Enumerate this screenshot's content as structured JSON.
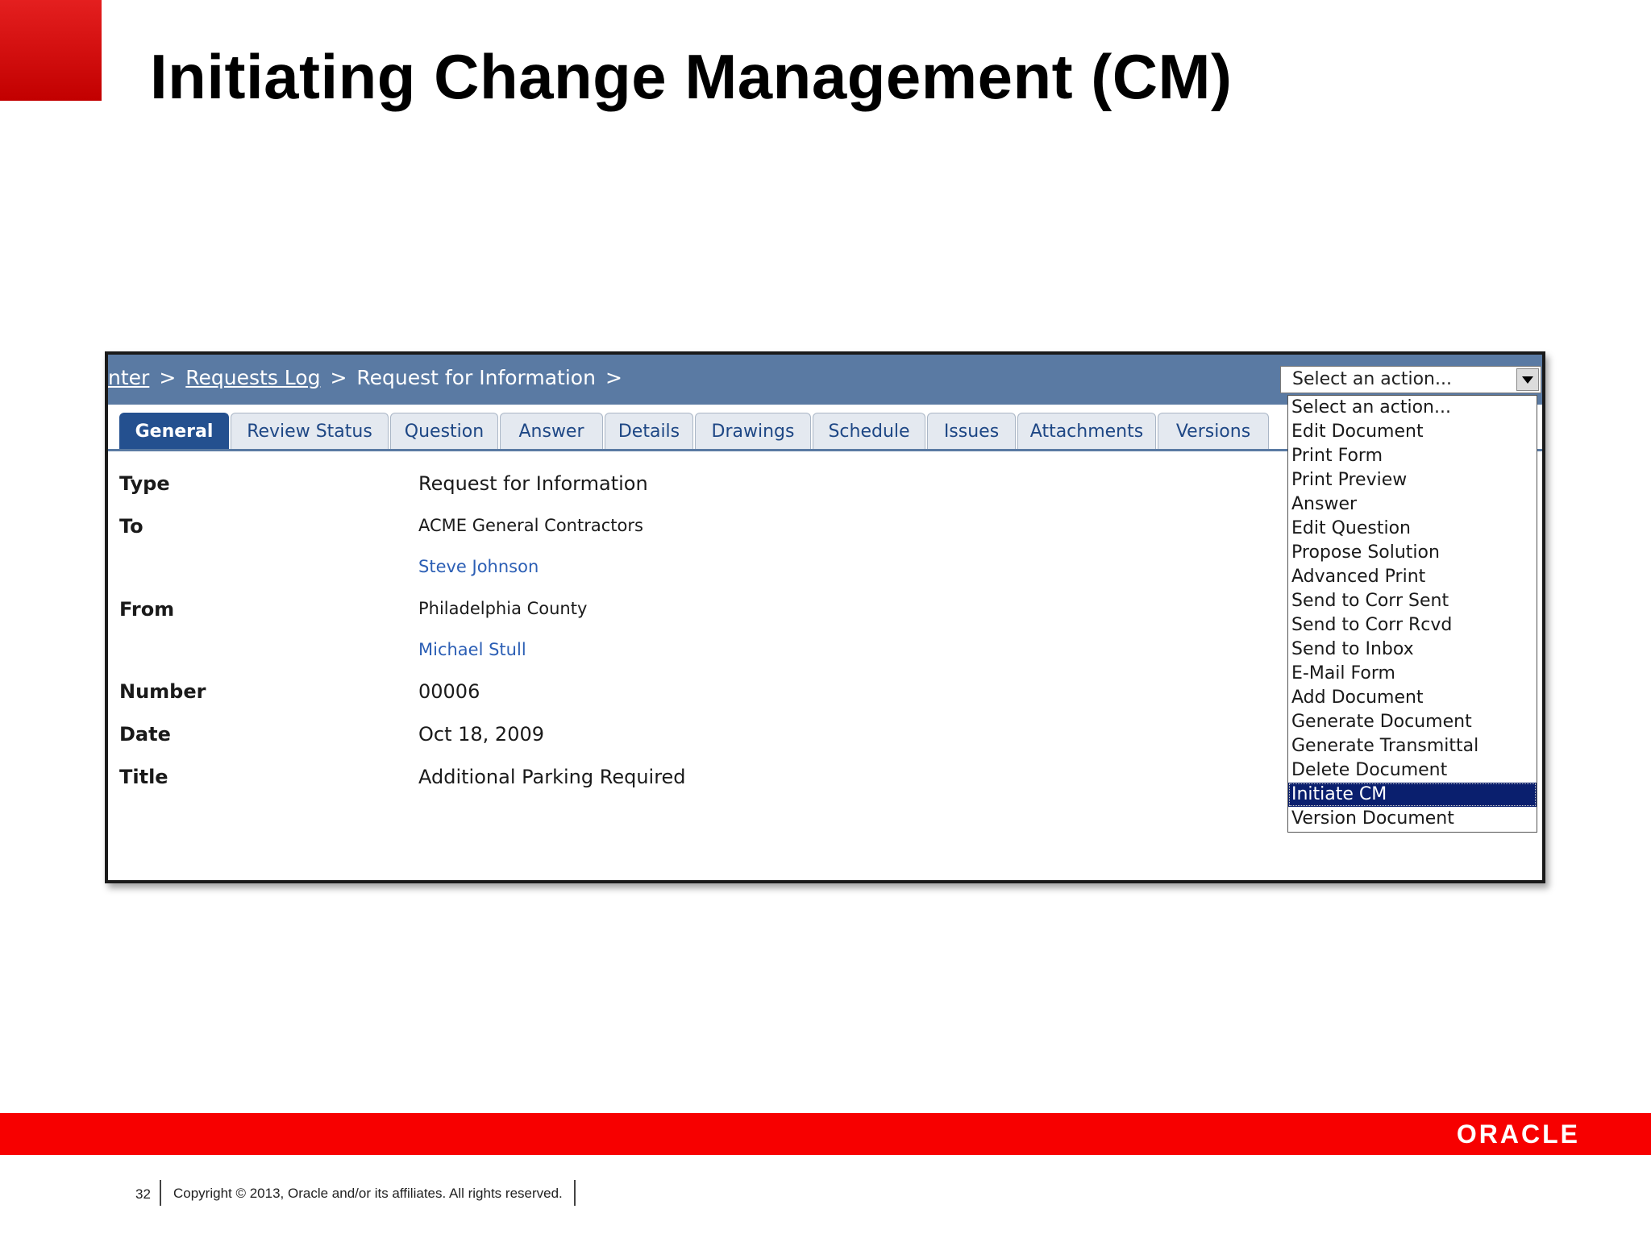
{
  "slide": {
    "title": "Initiating Change Management (CM)",
    "page_number": "32",
    "copyright": "Copyright © 2013, Oracle and/or its affiliates. All rights reserved.",
    "logo_text": "ORACLE"
  },
  "breadcrumb": {
    "item1": "nter",
    "item2": "Requests Log",
    "item3": "Request for Information",
    "separator": ">"
  },
  "action_select": {
    "value": "Select an action...",
    "options": [
      "Select an action...",
      "Edit Document",
      "Print Form",
      "Print Preview",
      "Answer",
      "Edit Question",
      "Propose Solution",
      "Advanced Print",
      "Send to Corr Sent",
      "Send to Corr Rcvd",
      "Send to Inbox",
      "E-Mail Form",
      "Add Document",
      "Generate Document",
      "Generate Transmittal",
      "Delete Document",
      "Initiate CM",
      "Version Document"
    ],
    "highlighted": "Initiate CM"
  },
  "tabs": [
    "General",
    "Review Status",
    "Question",
    "Answer",
    "Details",
    "Drawings",
    "Schedule",
    "Issues",
    "Attachments",
    "Versions"
  ],
  "active_tab": "General",
  "fields": {
    "type_label": "Type",
    "type_value": "Request for Information",
    "to_label": "To",
    "to_company": "ACME General Contractors",
    "to_contact": "Steve Johnson",
    "from_label": "From",
    "from_company": "Philadelphia County",
    "from_contact": "Michael Stull",
    "number_label": "Number",
    "number_value": "00006",
    "date_label": "Date",
    "date_value": "Oct 18, 2009",
    "title_label": "Title",
    "title_value": "Additional Parking Required"
  },
  "colors": {
    "brand_red": "#f70000",
    "header_blue": "#5a7aa3",
    "active_tab": "#24508f",
    "link_blue": "#2c5fb5",
    "selection": "#0a1f6e"
  }
}
